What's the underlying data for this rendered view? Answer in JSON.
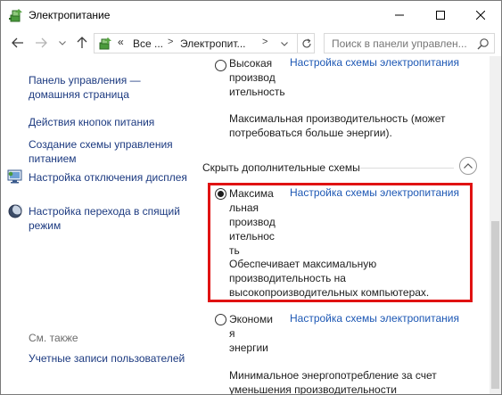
{
  "window": {
    "title": "Электропитание",
    "minimize_glyph": "—",
    "maximize_glyph": "☐",
    "close_glyph": "✕"
  },
  "navigation": {
    "back_icon": "arrow-left-icon",
    "forward_icon": "arrow-right-icon",
    "recent_icon": "chevron-down-icon",
    "up_icon": "arrow-up-icon",
    "address": {
      "overflow": "«",
      "all_items": "Все ...",
      "current": "Электропит...",
      "separator": ">"
    },
    "search_placeholder": "Поиск в панели управлен..."
  },
  "sidebar": {
    "home_link": "Панель управления — домашняя страница",
    "links": [
      {
        "label": "Действия кнопок питания",
        "icon": ""
      },
      {
        "label": "Создание схемы управления питанием",
        "icon": ""
      },
      {
        "label": "Настройка отключения дисплея",
        "icon": "monitor-icon"
      },
      {
        "label": "Настройка перехода в спящий режим",
        "icon": "moon-icon"
      }
    ],
    "see_also_title": "См. также",
    "see_also_links": [
      {
        "label": "Учетные записи пользователей"
      }
    ]
  },
  "main": {
    "plans_top": [
      {
        "name": "Высокая производительность",
        "name_lines": [
          "Высокая",
          "производ",
          "ительность"
        ],
        "link": "Настройка схемы электропитания",
        "description": "Максимальная производительность (может потребоваться больше энергии).",
        "selected": false
      }
    ],
    "hidden_section_title": "Скрыть дополнительные схемы",
    "plans_hidden": [
      {
        "name": "Максимальная производительность",
        "name_lines": [
          "Максима",
          "льная",
          "производ",
          "ительнос",
          "ть"
        ],
        "link": "Настройка схемы электропитания",
        "description": "Обеспечивает максимальную производительность на высокопроизводительных компьютерах.",
        "selected": true
      },
      {
        "name": "Экономия энергии",
        "name_lines": [
          "Экономи",
          "я",
          "энергии"
        ],
        "link": "Настройка схемы электропитания",
        "description": "Минимальное энергопотребление за счет уменьшения производительности компьютера, когда это возможно.",
        "selected": false
      }
    ]
  },
  "colors": {
    "link": "#1c57b4",
    "sidebar_link": "#1c3a80",
    "highlight": "#e01212"
  }
}
